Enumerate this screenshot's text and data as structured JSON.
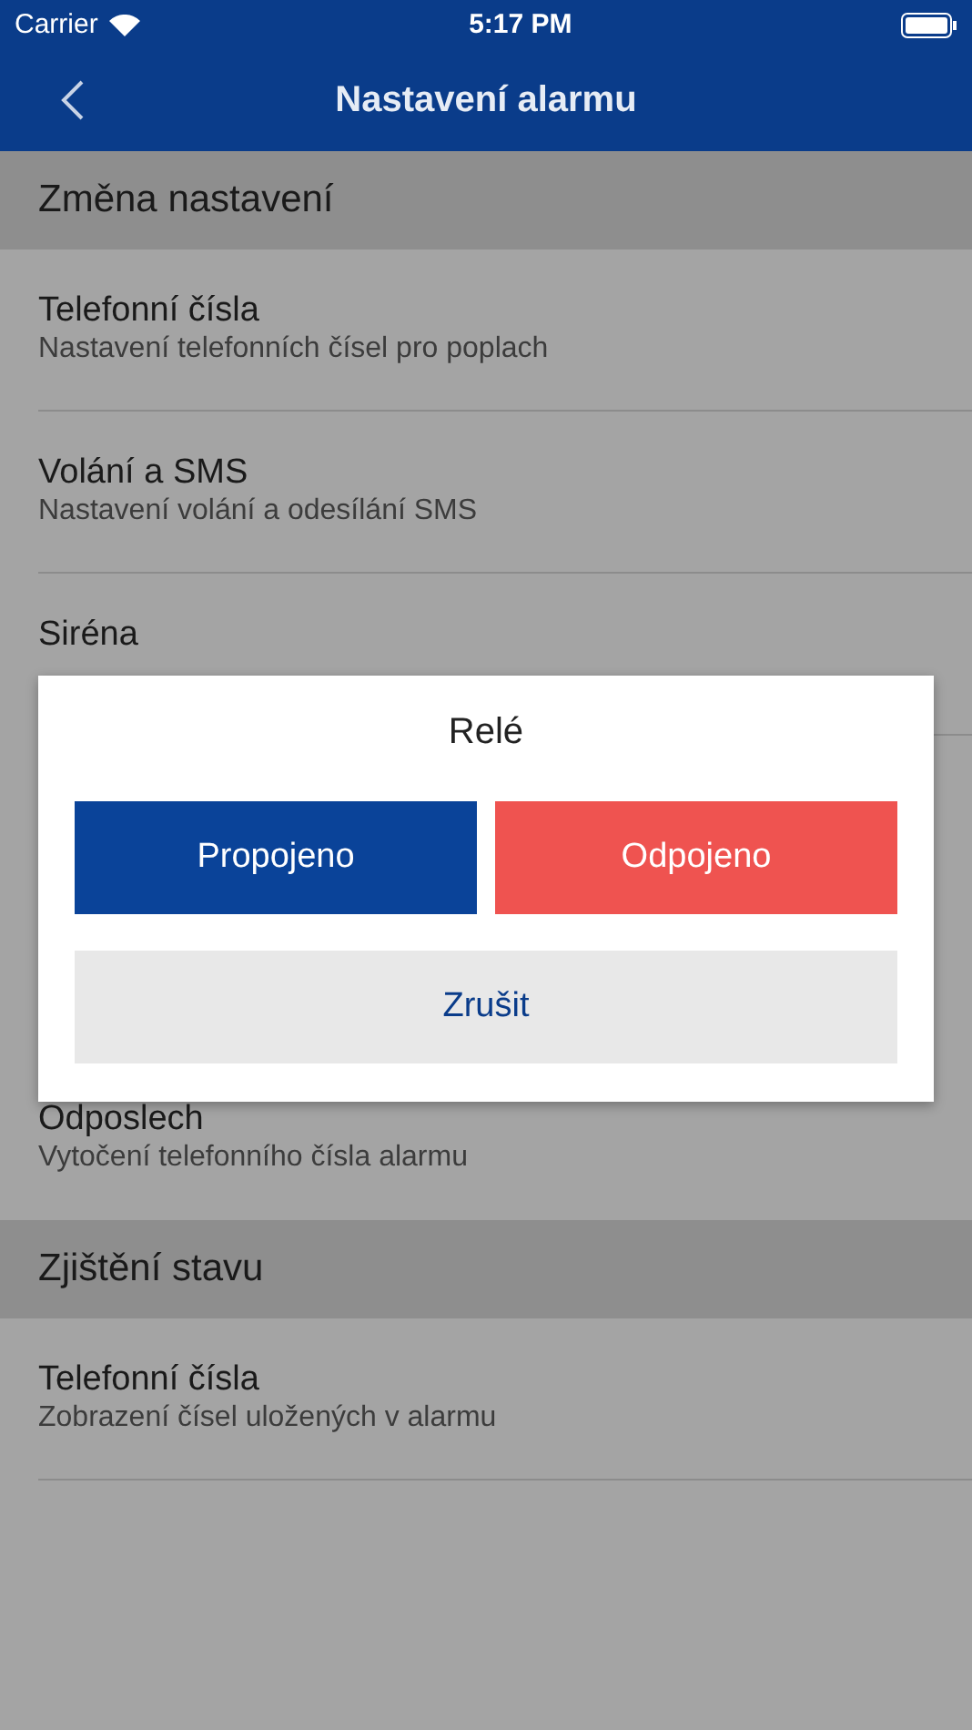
{
  "status_bar": {
    "carrier": "Carrier",
    "time": "5:17 PM"
  },
  "nav": {
    "title": "Nastavení alarmu"
  },
  "sections": [
    {
      "title": "Změna nastavení",
      "items": [
        {
          "title": "Telefonní čísla",
          "subtitle": "Nastavení telefonních čísel pro poplach"
        },
        {
          "title": "Volání a SMS",
          "subtitle": "Nastavení volání a odesílání SMS"
        },
        {
          "title": "Siréna"
        },
        {
          "title": "Odposlech",
          "subtitle": "Vytočení telefonního čísla alarmu"
        }
      ]
    },
    {
      "title": "Zjištění stavu",
      "items": [
        {
          "title": "Telefonní čísla",
          "subtitle": "Zobrazení čísel uložených v alarmu"
        }
      ]
    }
  ],
  "dialog": {
    "title": "Relé",
    "buttons": [
      {
        "label": "Propojeno",
        "kind": "primary"
      },
      {
        "label": "Odpojeno",
        "kind": "danger"
      }
    ],
    "cancel": "Zrušit"
  }
}
